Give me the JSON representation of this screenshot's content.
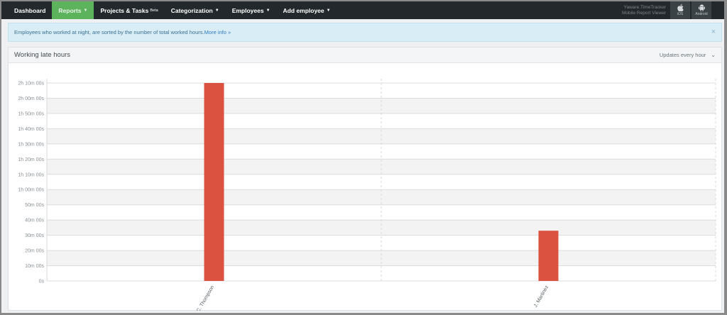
{
  "nav": {
    "items": [
      {
        "label": "Dashboard",
        "caret": false,
        "active": false
      },
      {
        "label": "Reports",
        "caret": true,
        "active": true
      },
      {
        "label": "Projects & Tasks",
        "sup": "Beta",
        "caret": false,
        "active": false
      },
      {
        "label": "Categorization",
        "caret": true,
        "active": false
      },
      {
        "label": "Employees",
        "caret": true,
        "active": false
      },
      {
        "label": "Add employee",
        "caret": true,
        "active": false
      }
    ],
    "brand_line1": "Yaware.TimeTracker",
    "brand_line2": "Mobile Report Viewer",
    "ios_label": "iOS",
    "android_label": "Android"
  },
  "alert": {
    "text": "Employees who worked at night, are sorted by the number of total worked hours.",
    "link": "More info »",
    "close": "×"
  },
  "panel": {
    "title": "Working late hours",
    "update_label": "Updates every hour"
  },
  "colors": {
    "accent": "#5cb35c",
    "bar": "#db5340",
    "nav_bg": "#22282b"
  },
  "chart_data": {
    "type": "bar",
    "categories": [
      "C. Thompson",
      "J. Martinez"
    ],
    "series": [
      {
        "values": [
          130,
          33
        ]
      }
    ],
    "value_unit": "minutes",
    "ylim": [
      0,
      130
    ],
    "ytick_step": 10,
    "yticks": [
      "0s",
      "10m 00s",
      "20m 00s",
      "30m 00s",
      "40m 00s",
      "50m 00s",
      "1h 00m 00s",
      "1h 10m 00s",
      "1h 20m 00s",
      "1h 30m 00s",
      "1h 40m 00s",
      "1h 50m 00s",
      "2h 00m 00s",
      "2h 10m 00s"
    ],
    "grid": true,
    "alternating_bands": true,
    "xlabel": "",
    "ylabel": ""
  }
}
